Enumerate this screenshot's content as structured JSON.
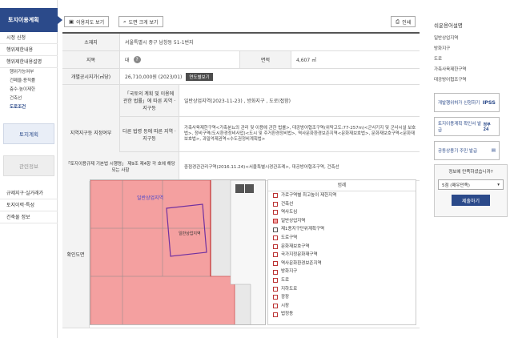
{
  "sidebar": {
    "title": "토지이용계획",
    "items": [
      {
        "label": "시정 신청"
      },
      {
        "label": "행위제한내용"
      },
      {
        "label": "행위제한내용설명"
      }
    ],
    "subs": [
      {
        "label": "행위가능여부"
      },
      {
        "label": "건폐율·용적률"
      },
      {
        "label": "층수·높이제한"
      },
      {
        "label": "건축선"
      },
      {
        "label": "도로조건"
      }
    ],
    "block1": "토지계획",
    "block2": "관련정보",
    "bottom_items": [
      {
        "label": "규제지구·실거래가"
      },
      {
        "label": "토지이력·특성"
      },
      {
        "label": "건축물 정보"
      }
    ]
  },
  "toolbar": {
    "map_btn": "이용지도 보기",
    "zoom_btn": "도면 크게 보기",
    "print_btn": "인쇄"
  },
  "table": {
    "addr_label": "소재지",
    "addr_value": "서울특별시 중구 남창동 51-1번지",
    "jimok_label": "지목",
    "jimok_value": "대",
    "area_label": "면적",
    "area_value": "4,607 ㎡",
    "price_label": "개별공시지가(㎡당)",
    "price_value": "26,710,000원 (2023/01)",
    "price_btn": "연도별보기",
    "zone_label": "지역지구등 지정여부",
    "law1_label": "「국토의 계획 및 이용에 관한 법률」에 따른 지역 · 지구등",
    "law1_value": "일반상업지역(2023-11-23) , 방화지구 , 도로(접함)",
    "law2_label": "다른 법령 등에 따른 지역 · 지구등",
    "law2_value": "가축사육제한구역<가축분뇨의 관리 및 이용에 관한 법률>, 대공방어협조구역(위탁고도:77-257m)<군사기지 및 군사시설 보호법>, 정비구역(도시환경정비사업)<도시 및 주거환경정비법>, 역사문화환경보존지역<문화재보호법>, 문화재보호구역<문화재보호법>, 과밀억제권역<수도권정비계획법>",
    "law3_label": "「토지이용규제 기본법 시행령」 제9조 제4항 각 호에 해당되는 사항",
    "law3_value": "중점경관관리구역(2016.11.24)<서울특별시경관조례>, 대공방어협조구역, 건축선",
    "map_label": "확인도면"
  },
  "map": {
    "labels": [
      "일반상업지역",
      "일반상업지역"
    ]
  },
  "legend": {
    "title": "범례",
    "items": [
      "가로구역별 최고높이 제한지역",
      "건축선",
      "역사도심",
      "일반상업지역",
      "제1종지구단위계획구역",
      "도로구역",
      "문화재보호구역",
      "국가지정문화재구역",
      "역사문화환경보존지역",
      "방화지구",
      "도로",
      "지하도로",
      "광장",
      "시장",
      "법정동"
    ]
  },
  "right": {
    "title": "쉬운용어설명",
    "links": [
      "일반상업지역",
      "방화지구",
      "도로",
      "가축사육제한구역",
      "대공방어협조구역"
    ],
    "card1_text": "개발행위허가 신청하기",
    "card1_logo": "IPSS",
    "card2_text": "토지이용계획 확인서 발급",
    "card2_logo": "정부24",
    "card3_text": "공동상용기 주민 발급",
    "survey_q": "정보에 만족하셨습니까?",
    "survey_opt": "5점 (매우만족)",
    "survey_btn": "제출하기"
  },
  "colors": {
    "primary": "#2b4a8a",
    "zone_red": "#f4a0a0"
  }
}
